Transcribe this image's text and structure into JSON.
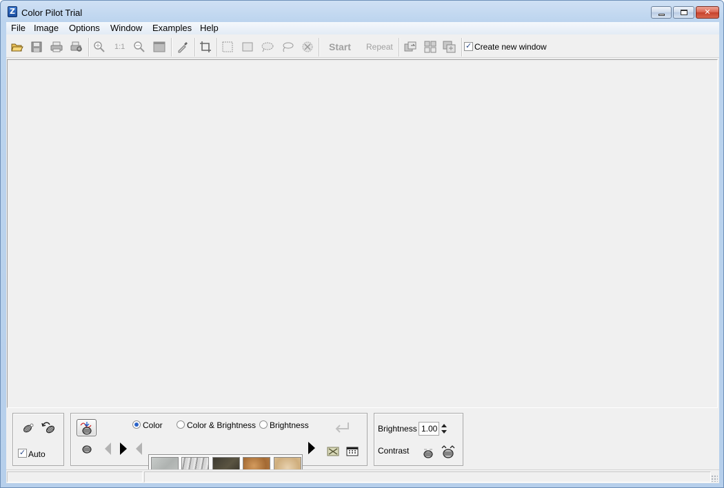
{
  "window": {
    "title": "Color Pilot Trial"
  },
  "menu": [
    "File",
    "Image",
    "Options",
    "Window",
    "Examples",
    "Help"
  ],
  "toolbar": {
    "start_label": "Start",
    "repeat_label": "Repeat",
    "create_new_window_label": "Create new window",
    "create_new_window_checked": true,
    "zoom_1to1_label": "1:1"
  },
  "bottom": {
    "auto_label": "Auto",
    "auto_checked": true,
    "mode_options": [
      "Color",
      "Color & Brightness",
      "Brightness"
    ],
    "mode_selected": "Color",
    "brightness_label": "Brightness",
    "brightness_value": "1.00",
    "contrast_label": "Contrast",
    "swatch_colors": [
      "#b9bcbb",
      "#c4c4c4",
      "#4a4436",
      "#b07a44",
      "#d6b98e"
    ]
  }
}
